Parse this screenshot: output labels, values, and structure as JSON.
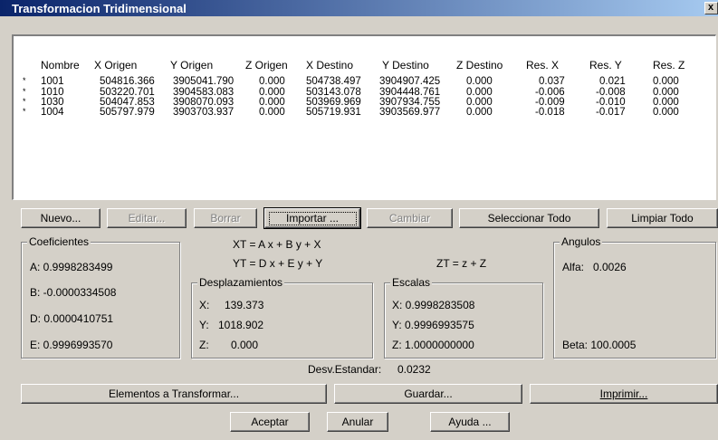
{
  "window": {
    "title": "Transformacion Tridimensional",
    "close_label": "x"
  },
  "table": {
    "headers": [
      "Nombre",
      "X Origen",
      "Y Origen",
      "Z Origen",
      "X Destino",
      "Y Destino",
      "Z Destino",
      "Res. X",
      "Res. Y",
      "Res. Z"
    ],
    "rows": [
      {
        "mark": "*",
        "cells": [
          "1001",
          "504816.366",
          "3905041.790",
          "0.000",
          "504738.497",
          "3904907.425",
          "0.000",
          "0.037",
          "0.021",
          "0.000"
        ]
      },
      {
        "mark": "*",
        "cells": [
          "1010",
          "503220.701",
          "3904583.083",
          "0.000",
          "503143.078",
          "3904448.761",
          "0.000",
          "-0.006",
          "-0.008",
          "0.000"
        ]
      },
      {
        "mark": "*",
        "cells": [
          "1030",
          "504047.853",
          "3908070.093",
          "0.000",
          "503969.969",
          "3907934.755",
          "0.000",
          "-0.009",
          "-0.010",
          "0.000"
        ]
      },
      {
        "mark": "*",
        "cells": [
          "1004",
          "505797.979",
          "3903703.937",
          "0.000",
          "505719.931",
          "3903569.977",
          "0.000",
          "-0.018",
          "-0.017",
          "0.000"
        ]
      }
    ]
  },
  "buttons": {
    "nuevo": "Nuevo...",
    "editar": "Editar...",
    "borrar": "Borrar",
    "importar": "Importar ...",
    "cambiar": "Cambiar",
    "seleccionar_todo": "Seleccionar Todo",
    "limpiar_todo": "Limpiar Todo",
    "elementos": "Elementos a Transformar...",
    "guardar": "Guardar...",
    "imprimir": "Imprimir...",
    "aceptar": "Aceptar",
    "anular": "Anular",
    "ayuda": "Ayuda ..."
  },
  "formulas": {
    "xt": "XT = A x + B y + X",
    "yt": "YT = D x + E y + Y",
    "zt": "ZT = z + Z"
  },
  "coeficientes": {
    "title": "Coeficientes",
    "a": "A: 0.9998283499",
    "b": "B: -0.0000334508",
    "d": "D: 0.0000410751",
    "e": "E: 0.9996993570"
  },
  "desplazamientos": {
    "title": "Desplazamientos",
    "x_label": "X:",
    "x_value": "139.373",
    "y_label": "Y:",
    "y_value": "1018.902",
    "z_label": "Z:",
    "z_value": "0.000"
  },
  "escalas": {
    "title": "Escalas",
    "x": "X: 0.9998283508",
    "y": "Y: 0.9996993575",
    "z": "Z: 1.0000000000"
  },
  "angulos": {
    "title": "Angulos",
    "alfa_label": "Alfa:",
    "alfa_value": "0.0026",
    "beta": "Beta: 100.0005"
  },
  "desv": {
    "label": "Desv.Estandar:",
    "value": "0.0232"
  }
}
